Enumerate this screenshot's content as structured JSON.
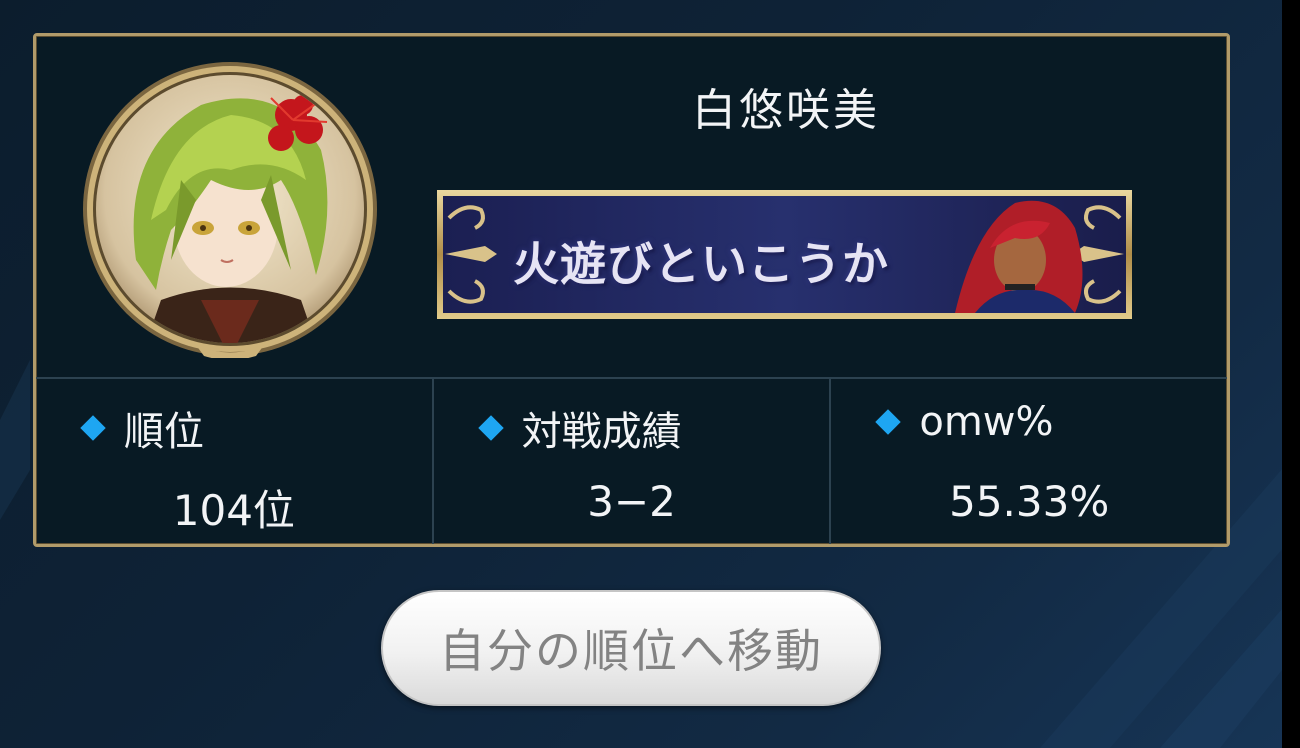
{
  "player": {
    "name": "白悠咲美",
    "avatar_icon": "character-avatar",
    "banner_text": "火遊びといこうか"
  },
  "stats": [
    {
      "label": "順位",
      "value": "104位"
    },
    {
      "label": "対戦成績",
      "value": "3−2"
    },
    {
      "label": "omw%",
      "value": "55.33%"
    }
  ],
  "button": {
    "label": "自分の順位へ移動"
  },
  "colors": {
    "frame_gold": "#b19b6a",
    "panel": "#081a24",
    "diamond": "#1ea6f2"
  }
}
